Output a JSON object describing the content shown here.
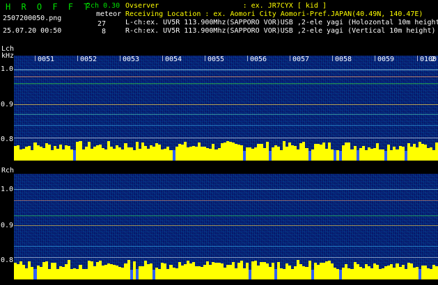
{
  "header": {
    "brand": "H R O F F T",
    "version": "2ch 0.30",
    "filename": "2507200050.png",
    "event_type": "meteor",
    "count_l": "27",
    "count_r": "8",
    "datetime": "25.07.20 00:50",
    "observer": "Ovserver                    : ex. JR7CYX [ kid ]",
    "location": "Receiving Location : ex. Aomori City Aomori-Pref.JAPAN(40.49N, 140.47E)",
    "lch_info": "L-ch:ex. UV5R 113.900Mhz(SAPPORO VOR)USB ,2-ele yagi (Holozontal 10m height",
    "rch_info": "R-ch:ex. UV5R 113.900Mhz(SAPPORO VOR)USB ,2-ele yagi (Vertical 10m height)"
  },
  "lch": {
    "label": "Lch",
    "unit": "kHz",
    "yticks": [
      "1.0",
      "0.9",
      "0.8"
    ]
  },
  "rch": {
    "label": "Rch",
    "yticks": [
      "1.0",
      "0.9",
      "0.8"
    ]
  },
  "time_labels": [
    "0051",
    "0052",
    "0053",
    "0054",
    "0055",
    "0056",
    "0057",
    "0058",
    "0059",
    "0100",
    "2"
  ],
  "colors": {
    "accent_green": "#00e000",
    "info_yellow": "#ffff00",
    "background": "#07186a",
    "level_bar": "#ffff00"
  }
}
